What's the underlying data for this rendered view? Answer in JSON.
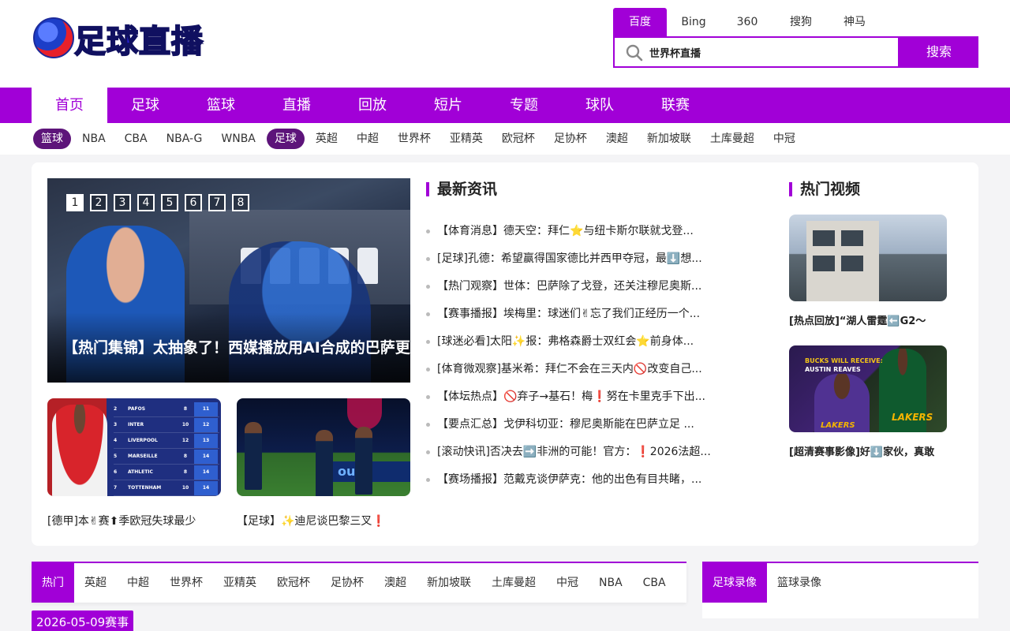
{
  "brand": {
    "name": "足球直播"
  },
  "search": {
    "engines": [
      "百度",
      "Bing",
      "360",
      "搜狗",
      "神马"
    ],
    "active_engine": 0,
    "value": "世界杯直播",
    "button": "搜索"
  },
  "main_nav": {
    "items": [
      "首页",
      "足球",
      "篮球",
      "直播",
      "回放",
      "短片",
      "专题",
      "球队",
      "联赛"
    ],
    "active": 0
  },
  "sub_nav": {
    "items": [
      "篮球",
      "NBA",
      "CBA",
      "NBA-G",
      "WNBA",
      "足球",
      "英超",
      "中超",
      "世界杯",
      "亚精英",
      "欧冠杯",
      "足协杯",
      "澳超",
      "新加坡联",
      "土库曼超",
      "中冠"
    ],
    "category_pills": [
      0,
      5
    ]
  },
  "hero": {
    "title": "【热门集锦】太抽象了！西媒播放用AI合成的巴萨更衣室视频",
    "pages": [
      "1",
      "2",
      "3",
      "4",
      "5",
      "6",
      "7",
      "8"
    ],
    "active_page": 0
  },
  "thumbs": [
    {
      "caption": "[德甲]本✌赛⬆季欧冠失球最少",
      "table": [
        {
          "pos": "2",
          "team": "PAFOS",
          "a": "8",
          "b": "11"
        },
        {
          "pos": "3",
          "team": "INTER",
          "a": "10",
          "b": "12"
        },
        {
          "pos": "4",
          "team": "LIVERPOOL",
          "a": "12",
          "b": "13"
        },
        {
          "pos": "5",
          "team": "MARSEILLE",
          "a": "8",
          "b": "14"
        },
        {
          "pos": "6",
          "team": "ATHLETIC",
          "a": "8",
          "b": "14"
        },
        {
          "pos": "7",
          "team": "TOTTENHAM",
          "a": "10",
          "b": "14"
        }
      ]
    },
    {
      "caption": "【足球】✨迪尼谈巴黎三叉❗",
      "banner": "ou c"
    }
  ],
  "news": {
    "title": "最新资讯",
    "items": [
      "【体育消息】德天空：拜仁⭐与纽卡斯尔联就戈登...",
      "[足球]孔德：希望赢得国家德比并西甲夺冠，最⬇️想...",
      "【热门观察】世体：巴萨除了戈登，还关注穆尼奥斯...",
      "【赛事播报】埃梅里：球迷们✌忘了我们正经历一个...",
      "[球迷必看]太阳✨报：弗格森爵士双红会⭐前身体...",
      "[体育微观察]基米希：拜仁不会在三天内🚫改变自己...",
      "【体坛热点】🚫弃子→基石！梅❗努在卡里克手下出...",
      "【要点汇总】戈伊科切亚：穆尼奥斯能在巴萨立足 ...",
      "[滚动快讯]否决去➡️非洲的可能！官方：❗2026法超...",
      "【赛场播报】范戴克谈伊萨克：他的出色有目共睹，..."
    ]
  },
  "videos": {
    "title": "热门视频",
    "items": [
      {
        "caption": "[热点回放]“湖人雷霆⬅️G2～"
      },
      {
        "caption": "[超清赛事影像]好⬇️家伙，真敢",
        "overlay_line1": "BUCKS WILL RECEIVE:",
        "overlay_line2": "AUSTIN REAVES",
        "logo_text": "LAKERS"
      }
    ]
  },
  "schedule": {
    "tabs": [
      "热门",
      "英超",
      "中超",
      "世界杯",
      "亚精英",
      "欧冠杯",
      "足协杯",
      "澳超",
      "新加坡联",
      "土库曼超",
      "中冠",
      "NBA",
      "CBA"
    ],
    "active": 0,
    "date_label": "2026-05-09赛事"
  },
  "records": {
    "tabs": [
      "足球录像",
      "篮球录像"
    ],
    "active": 0
  },
  "colors": {
    "accent": "#a100d7",
    "pill": "#5d147a"
  }
}
